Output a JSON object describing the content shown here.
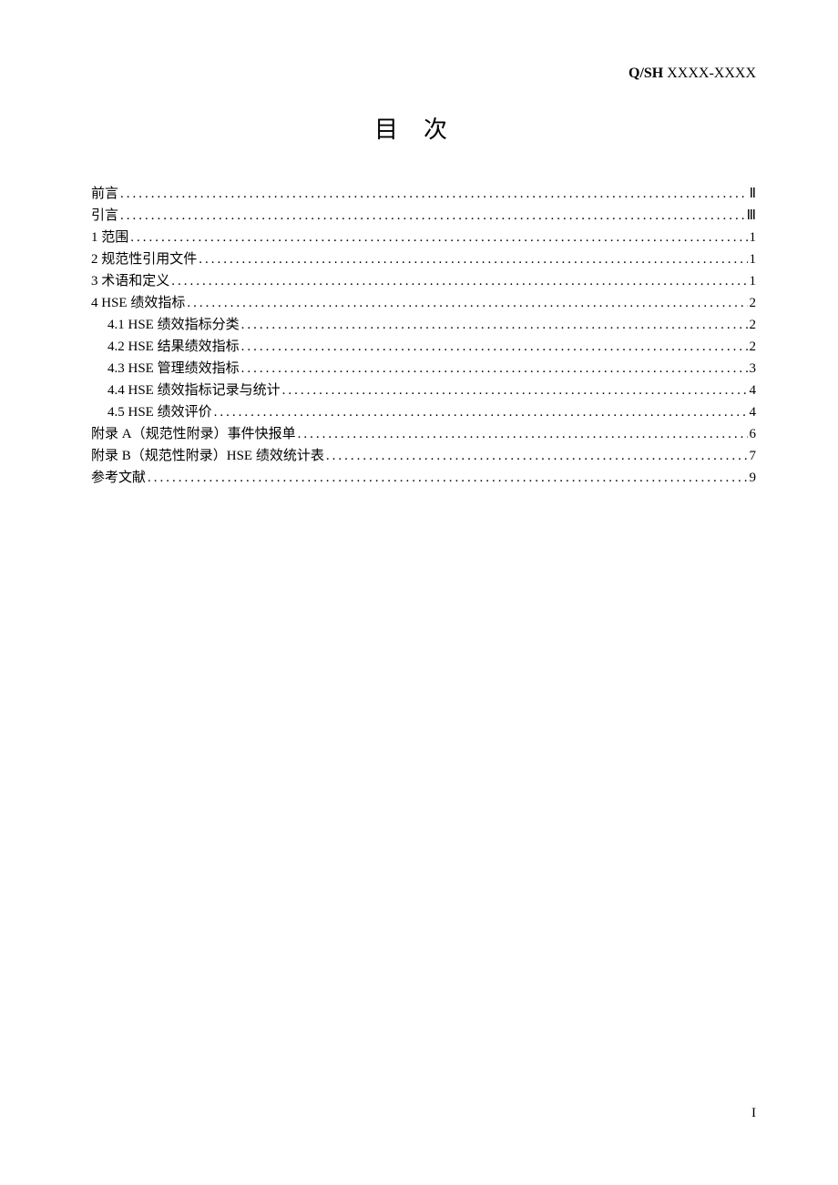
{
  "header": {
    "code_prefix": "Q/SH",
    "code_suffix": " XXXX-XXXX"
  },
  "title": "目次",
  "toc": [
    {
      "label": "前言",
      "page": "Ⅱ",
      "indent": 0
    },
    {
      "label": "引言",
      "page": "Ⅲ",
      "indent": 0
    },
    {
      "label": "1  范围",
      "page": "1",
      "indent": 0
    },
    {
      "label": "2  规范性引用文件",
      "page": "1",
      "indent": 0
    },
    {
      "label": "3  术语和定义",
      "page": "1",
      "indent": 0
    },
    {
      "label": "4  HSE 绩效指标 ",
      "page": "2",
      "indent": 0
    },
    {
      "label": "4.1 HSE 绩效指标分类 ",
      "page": "2",
      "indent": 1
    },
    {
      "label": "4.2 HSE 结果绩效指标  ",
      "page": "2",
      "indent": 1
    },
    {
      "label": "4.3 HSE 管理绩效指标 ",
      "page": "3",
      "indent": 1
    },
    {
      "label": "4.4 HSE 绩效指标记录与统计 ",
      "page": "4",
      "indent": 1
    },
    {
      "label": "4.5 HSE 绩效评价 ",
      "page": "4",
      "indent": 1
    },
    {
      "label": "附录 A（规范性附录）事件快报单 ",
      "page": "6",
      "indent": 0
    },
    {
      "label": "附录 B（规范性附录）HSE 绩效统计表",
      "page": "7",
      "indent": 0
    },
    {
      "label": "参考文献",
      "page": "9",
      "indent": 0
    }
  ],
  "footer_page": "I"
}
